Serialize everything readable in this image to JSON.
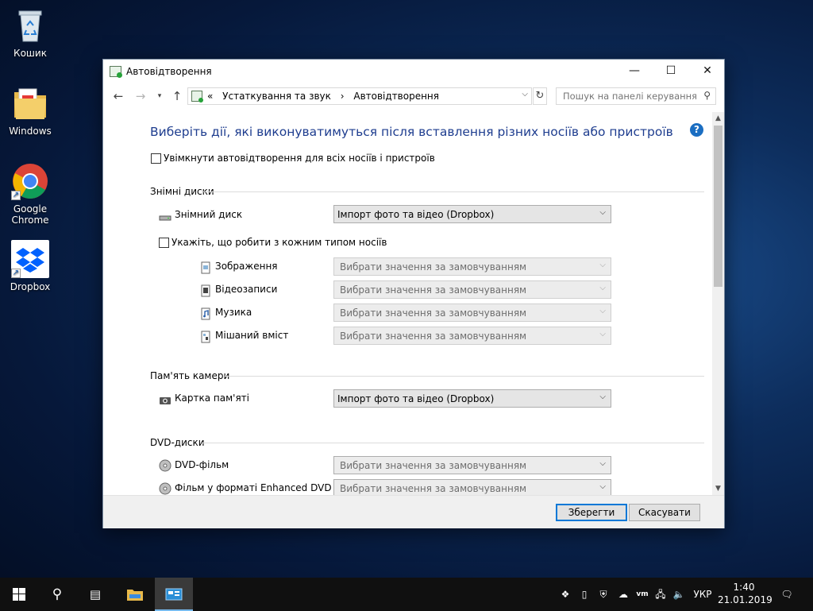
{
  "desktop": {
    "icons": [
      {
        "label": "Кошик"
      },
      {
        "label": "Windows"
      },
      {
        "label": "Google Chrome"
      },
      {
        "label": "Dropbox"
      }
    ]
  },
  "window": {
    "title": "Автовідтворення",
    "breadcrumb": [
      "«",
      "Устаткування та звук",
      "›",
      "Автовідтворення"
    ],
    "search_placeholder": "Пошук на панелі керування"
  },
  "content": {
    "heading": "Виберіть дії, які виконуватимуться після вставлення різних носіїв або пристроїв",
    "use_autoplay_label": "Увімкнути автовідтворення для всіх носіїв і пристроїв",
    "sections": {
      "removable": {
        "title": "Знімні диски",
        "drive_label": "Знімний диск",
        "drive_value": "Імпорт фото та відео (Dropbox)",
        "per_type_label": "Укажіть, що робити з кожним типом носіїв",
        "types": [
          {
            "label": "Зображення",
            "value": "Вибрати значення за замовчуванням"
          },
          {
            "label": "Відеозаписи",
            "value": "Вибрати значення за замовчуванням"
          },
          {
            "label": "Музика",
            "value": "Вибрати значення за замовчуванням"
          },
          {
            "label": "Мішаний вміст",
            "value": "Вибрати значення за замовчуванням"
          }
        ]
      },
      "camera": {
        "title": "Пам'ять камери",
        "card_label": "Картка пам'яті",
        "card_value": "Імпорт фото та відео (Dropbox)"
      },
      "dvd": {
        "title": "DVD-диски",
        "items": [
          {
            "label": "DVD-фільм",
            "value": "Вибрати значення за замовчуванням"
          },
          {
            "label": "Фільм у форматі Enhanced DVD",
            "value": "Вибрати значення за замовчуванням"
          }
        ]
      }
    }
  },
  "footer": {
    "save_label": "Зберегти",
    "cancel_label": "Скасувати"
  },
  "taskbar": {
    "language": "УКР",
    "time": "1:40",
    "date": "21.01.2019"
  },
  "colors": {
    "heading": "#1e3d8f",
    "accent": "#0078d7"
  }
}
